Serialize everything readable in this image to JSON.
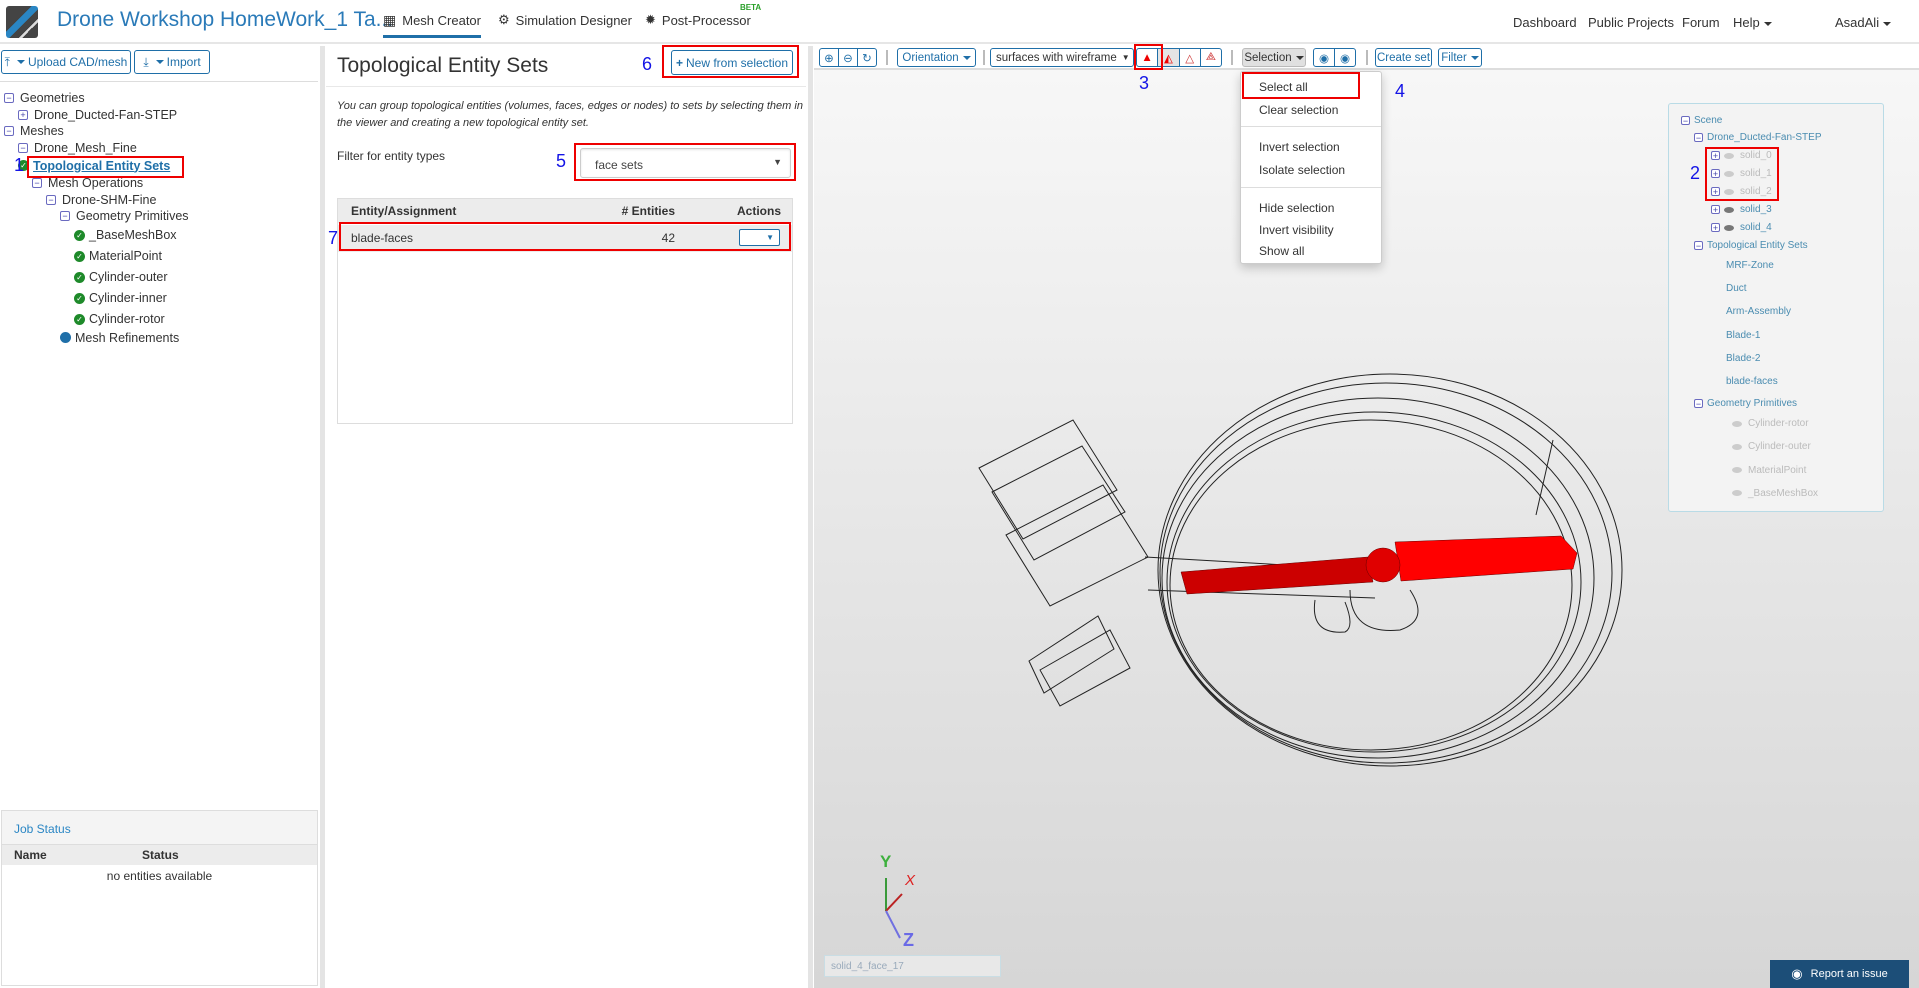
{
  "header": {
    "title": "Drone Workshop HomeWork_1 Ta...",
    "tabs": [
      {
        "label": "Mesh Creator",
        "icon": "grid-icon"
      },
      {
        "label": "Simulation Designer",
        "icon": "gears-icon"
      },
      {
        "label": "Post-Processor",
        "icon": "cog-icon"
      }
    ],
    "beta": "BETA",
    "links": {
      "dashboard": "Dashboard",
      "public_projects": "Public Projects",
      "forum": "Forum",
      "help": "Help",
      "user": "AsadAli"
    }
  },
  "left": {
    "upload_label": "Upload CAD/mesh",
    "import_label": "Import",
    "tree": [
      {
        "label": "Geometries",
        "icon": "minus",
        "indent": 0
      },
      {
        "label": "Drone_Ducted-Fan-STEP",
        "icon": "plus",
        "indent": 1
      },
      {
        "label": "Meshes",
        "icon": "minus",
        "indent": 0
      },
      {
        "label": "Drone_Mesh_Fine",
        "icon": "minus",
        "indent": 1
      },
      {
        "label": "Topological Entity Sets",
        "icon": "check",
        "indent": 1,
        "selected": true
      },
      {
        "label": "Mesh Operations",
        "icon": "minus",
        "indent": 2
      },
      {
        "label": "Drone-SHM-Fine",
        "icon": "minus",
        "indent": 3
      },
      {
        "label": "Geometry Primitives",
        "icon": "minus",
        "indent": 4
      },
      {
        "label": "_BaseMeshBox",
        "icon": "check",
        "indent": 5
      },
      {
        "label": "MaterialPoint",
        "icon": "check",
        "indent": 5
      },
      {
        "label": "Cylinder-outer",
        "icon": "check",
        "indent": 5
      },
      {
        "label": "Cylinder-inner",
        "icon": "check",
        "indent": 5
      },
      {
        "label": "Cylinder-rotor",
        "icon": "check",
        "indent": 5
      },
      {
        "label": "Mesh Refinements",
        "icon": "dot",
        "indent": 4
      }
    ],
    "job_status": {
      "title": "Job Status",
      "col_name": "Name",
      "col_status": "Status",
      "empty": "no entities available"
    }
  },
  "middle": {
    "title": "Topological Entity Sets",
    "new_button": "New from selection",
    "description": "You can group topological entities (volumes, faces, edges or nodes) to sets by selecting them in the viewer and creating a new topological entity set.",
    "filter_label": "Filter for entity types",
    "filter_value": "face sets",
    "table": {
      "headers": [
        "Entity/Assignment",
        "# Entities",
        "Actions"
      ],
      "rows": [
        {
          "name": "blade-faces",
          "count": "42"
        }
      ]
    }
  },
  "annotations": [
    "1",
    "2",
    "3",
    "4",
    "5",
    "6",
    "7"
  ],
  "viewer": {
    "orientation": "Orientation",
    "render_mode": "surfaces with wireframe",
    "selection": "Selection",
    "create_set": "Create set",
    "filter": "Filter",
    "menu": [
      "Select all",
      "Clear selection",
      "Invert selection",
      "Isolate selection",
      "Hide selection",
      "Invert visibility",
      "Show all"
    ],
    "scene": {
      "root": "Scene",
      "geometry": "Drone_Ducted-Fan-STEP",
      "solids": [
        {
          "label": "solid_0",
          "visible": false
        },
        {
          "label": "solid_1",
          "visible": false
        },
        {
          "label": "solid_2",
          "visible": false
        },
        {
          "label": "solid_3",
          "visible": true
        },
        {
          "label": "solid_4",
          "visible": true
        }
      ],
      "sets_label": "Topological Entity Sets",
      "sets": [
        "MRF-Zone",
        "Duct",
        "Arm-Assembly",
        "Blade-1",
        "Blade-2",
        "blade-faces"
      ],
      "prims_label": "Geometry Primitives",
      "prims": [
        "Cylinder-rotor",
        "Cylinder-outer",
        "MaterialPoint",
        "_BaseMeshBox"
      ]
    },
    "axes": {
      "x": "X",
      "y": "Y",
      "z": "Z"
    },
    "picked": "solid_4_face_17",
    "report": "Report an issue"
  },
  "colors": {
    "accent": "#1f6fa8",
    "selection": "#ff0000",
    "annotation": "#1414e6"
  }
}
